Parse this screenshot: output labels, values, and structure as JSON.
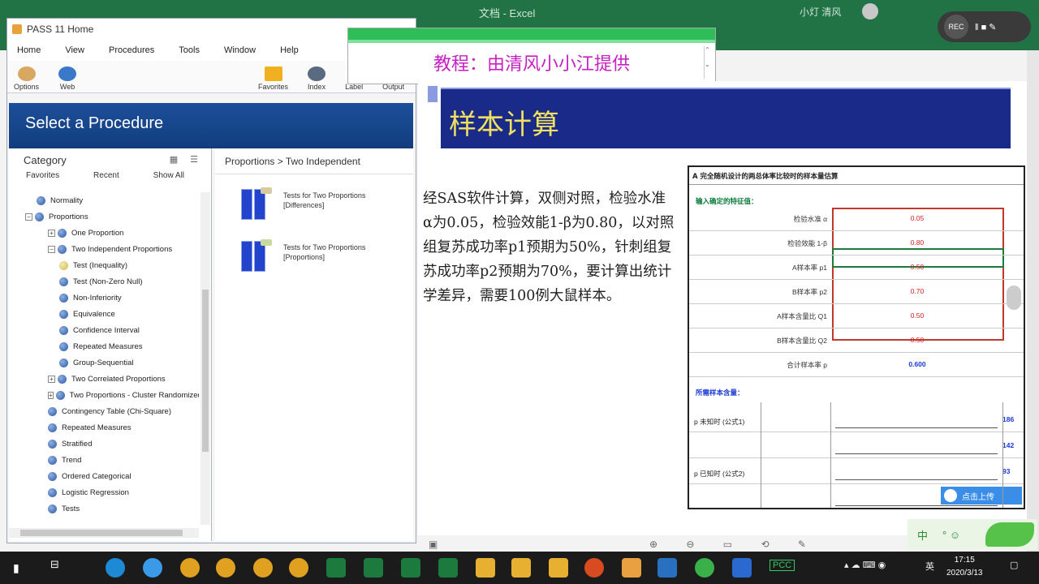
{
  "excel": {
    "title": "文档 - Excel",
    "account": "小灯 清风",
    "window_icons": [
      "—",
      "□",
      "✕"
    ]
  },
  "recorder": {
    "label": "REC",
    "controls": "‖ ■ ✎"
  },
  "pass": {
    "title": "PASS 11 Home",
    "menu": [
      "Home",
      "View",
      "Procedures",
      "Tools",
      "Window",
      "Help"
    ],
    "toolbar": [
      {
        "label": "Options",
        "color": "#d8a860"
      },
      {
        "label": "Web",
        "color": "#3a78c8"
      },
      {
        "label": "Favorites",
        "color": "#f0b020"
      },
      {
        "label": "Index",
        "color": "#5a6a80"
      },
      {
        "label": "Label",
        "color": "#ffffff"
      },
      {
        "label": "Output",
        "color": "#ffffff"
      }
    ],
    "header": "Select a Procedure",
    "category_label": "Category",
    "category_links": [
      "Favorites",
      "Recent",
      "Show All"
    ],
    "tree": [
      {
        "label": "Normality",
        "indent": 1,
        "exp": ""
      },
      {
        "label": "Proportions",
        "indent": 0,
        "exp": "−"
      },
      {
        "label": "One Proportion",
        "indent": 2,
        "exp": "+"
      },
      {
        "label": "Two Independent Proportions",
        "indent": 2,
        "exp": "−"
      },
      {
        "label": "Test (Inequality)",
        "indent": 3,
        "exp": "",
        "selected": true
      },
      {
        "label": "Test (Non-Zero Null)",
        "indent": 3,
        "exp": ""
      },
      {
        "label": "Non-Inferiority",
        "indent": 3,
        "exp": ""
      },
      {
        "label": "Equivalence",
        "indent": 3,
        "exp": ""
      },
      {
        "label": "Confidence Interval",
        "indent": 3,
        "exp": ""
      },
      {
        "label": "Repeated Measures",
        "indent": 3,
        "exp": ""
      },
      {
        "label": "Group-Sequential",
        "indent": 3,
        "exp": ""
      },
      {
        "label": "Two Correlated Proportions",
        "indent": 2,
        "exp": "+"
      },
      {
        "label": "Two Proportions - Cluster Randomized",
        "indent": 2,
        "exp": "+"
      },
      {
        "label": "Contingency Table (Chi-Square)",
        "indent": 2,
        "exp": ""
      },
      {
        "label": "Repeated Measures",
        "indent": 2,
        "exp": ""
      },
      {
        "label": "Stratified",
        "indent": 2,
        "exp": ""
      },
      {
        "label": "Trend",
        "indent": 2,
        "exp": ""
      },
      {
        "label": "Ordered Categorical",
        "indent": 2,
        "exp": ""
      },
      {
        "label": "Logistic Regression",
        "indent": 2,
        "exp": ""
      },
      {
        "label": "Tests",
        "indent": 2,
        "exp": ""
      }
    ],
    "breadcrumb": "Proportions > Two Independent",
    "procedures": [
      {
        "label": "Tests for Two Proportions [Differences]"
      },
      {
        "label": "Tests for Two Proportions [Proportions]"
      }
    ]
  },
  "caption": {
    "text": "教程：由清风小小江提供"
  },
  "slide": {
    "title": "样本计算",
    "body": "经SAS软件计算，双侧对照，检验水准α为0.05，检验效能1-β为0.80，以对照组复苏成功率p1预期为50%，针刺组复苏成功率p2预期为70%，要计算出统计学差异，需要100例大鼠样本。",
    "table": {
      "title": "A 完全随机设计的两总体率比较时的样本量估算",
      "input_header": "输入确定的特征值：",
      "rows": [
        {
          "label": "检验水准 α",
          "value": "0.05"
        },
        {
          "label": "检验效能 1-β",
          "value": "0.80"
        },
        {
          "label": "A样本率 p1",
          "value": "0.50"
        },
        {
          "label": "B样本率 p2",
          "value": "0.70"
        },
        {
          "label": "A样本含量比 Q1",
          "value": "0.50"
        },
        {
          "label": "B样本含量比 Q2",
          "value": "0.50"
        },
        {
          "label": "合计样本率 p",
          "value": "0.600"
        }
      ],
      "result_header": "所需样本含量：",
      "results": [
        {
          "group": "p 未知时 (公式1)",
          "value": "186"
        },
        {
          "group": "",
          "value": "142"
        },
        {
          "group": "p 已知时 (公式2)",
          "value": "93"
        },
        {
          "group": "",
          "value": ""
        }
      ],
      "upload_label": "点击上传"
    },
    "tools": "⊕ ⊖ ▭ ⟲ ✎"
  },
  "ime": {
    "label": "中",
    "extra": "° ☺"
  },
  "taskbar": {
    "clock_time": "17:15",
    "clock_date": "2020/3/13",
    "tray_lang": "英",
    "tray_badge": "PCC"
  }
}
